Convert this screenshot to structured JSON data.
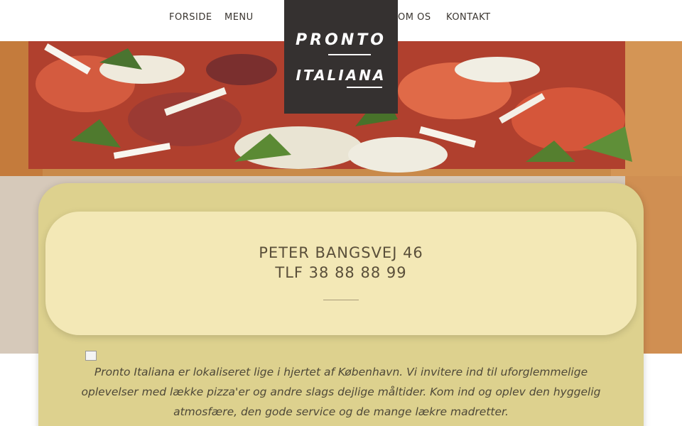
{
  "nav": {
    "left": [
      "FORSIDE",
      "MENU"
    ],
    "right": [
      "OM OS",
      "KONTAKT"
    ]
  },
  "logo": {
    "line1": "PRONTO",
    "line2": "ITALIANA"
  },
  "contact": {
    "address": "PETER BANGSVEJ 46",
    "phone": "TLF 38 88 88 99"
  },
  "intro_text": "Pronto Italiana er lokaliseret lige i hjertet af København. Vi invitere ind til uforglemmelige oplevelser med lække pizza'er og andre slags dejlige måltider. Kom ind og oplev den hyggelig atmosfære, den gode service og de mange lækre madretter.",
  "colors": {
    "logo_bg": "#353130",
    "panel": "#ddd18e",
    "address_box": "#f3e8b6",
    "text": "#5a4f3a"
  }
}
